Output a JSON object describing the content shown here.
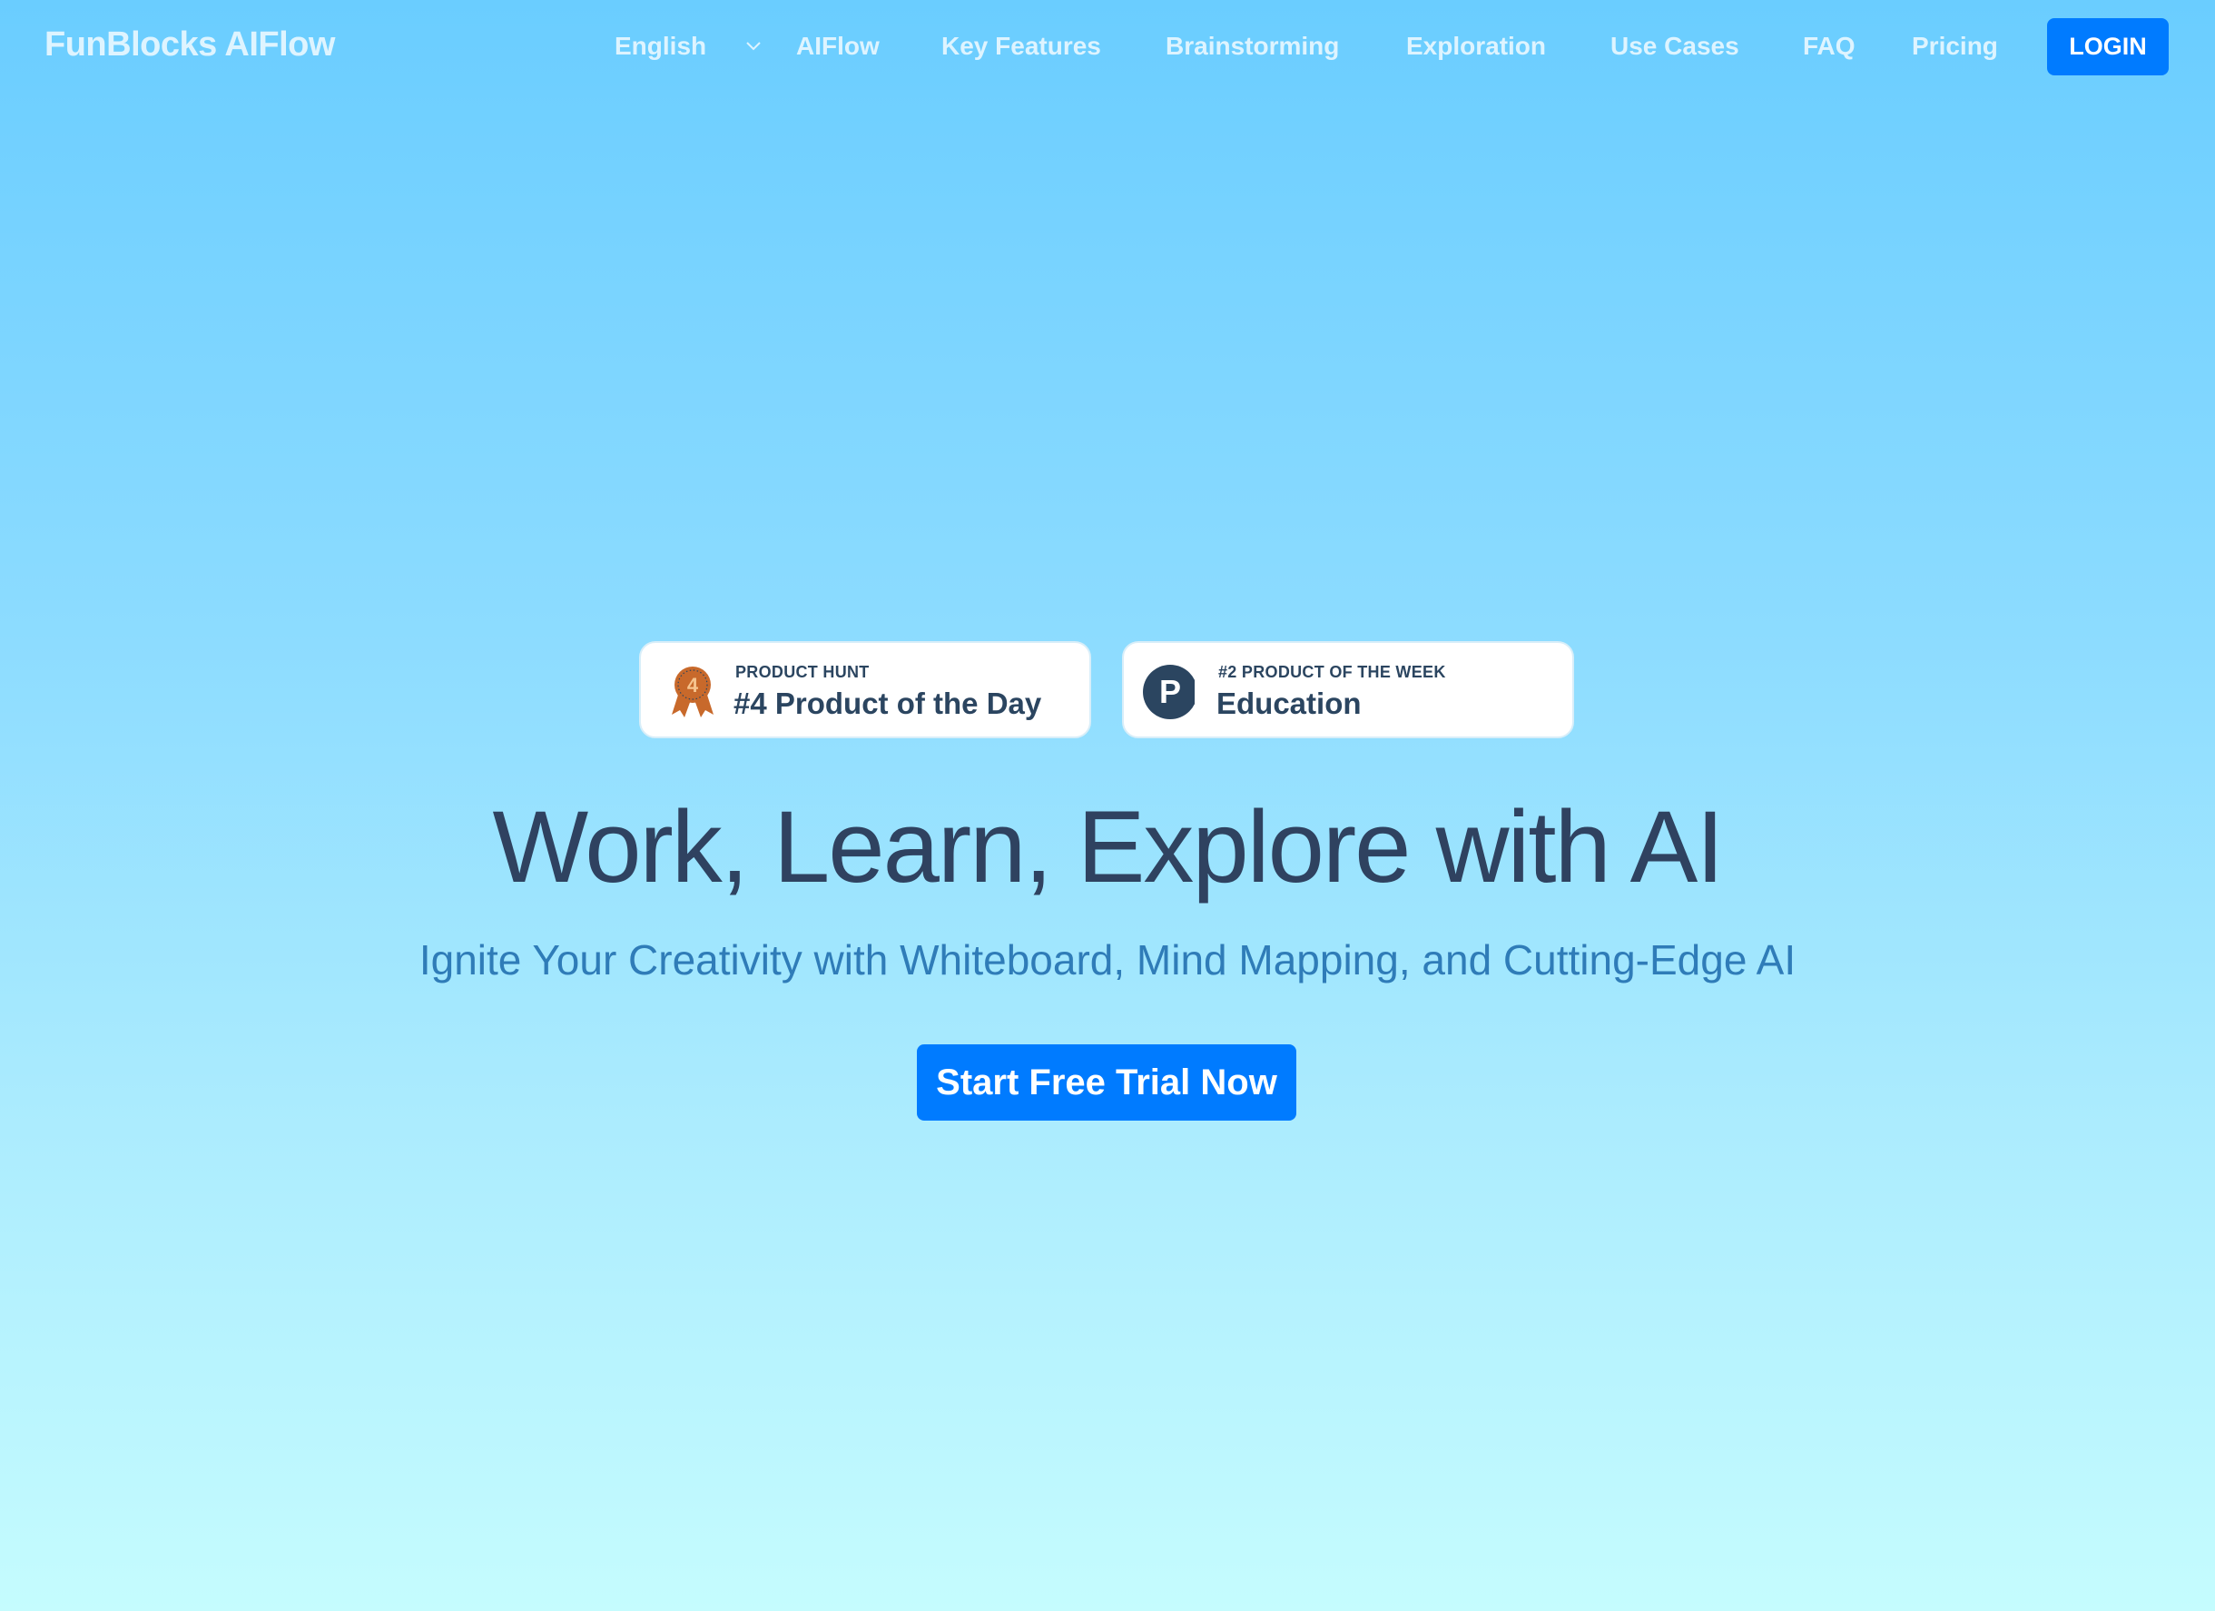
{
  "header": {
    "logo": "FunBlocks AIFlow",
    "language": {
      "selected": "English",
      "icon": "chevron-down-icon"
    },
    "nav": [
      {
        "label": "AIFlow"
      },
      {
        "label": "Key Features"
      },
      {
        "label": "Brainstorming"
      },
      {
        "label": "Exploration"
      },
      {
        "label": "Use Cases"
      },
      {
        "label": "FAQ"
      },
      {
        "label": "Pricing"
      }
    ],
    "login_label": "LOGIN"
  },
  "badges": [
    {
      "icon": "award-medal-icon",
      "icon_number": "4",
      "kicker": "PRODUCT HUNT",
      "title": "#4 Product of the Day"
    },
    {
      "icon": "product-hunt-logo-icon",
      "icon_letter": "P",
      "kicker": "#2 PRODUCT OF THE WEEK",
      "title": "Education"
    }
  ],
  "hero": {
    "headline": "Work, Learn, Explore with AI",
    "subtitle": "Ignite Your Creativity with Whiteboard, Mind Mapping, and Cutting-Edge AI",
    "cta_label": "Start Free Trial Now"
  },
  "colors": {
    "accent": "#007bff",
    "heading": "#2f4260",
    "subtitle": "#2f7cb8",
    "medal": "#c8692b",
    "ph_circle": "#2b4560"
  }
}
